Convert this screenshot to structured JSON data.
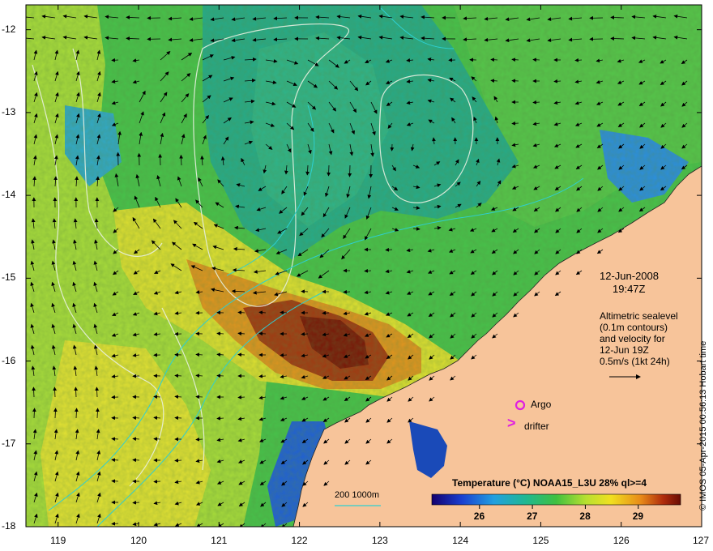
{
  "map": {
    "lon_ticks": [
      "119",
      "120",
      "121",
      "122",
      "123",
      "124",
      "125",
      "126",
      "127"
    ],
    "lat_ticks": [
      "-12",
      "-13",
      "-14",
      "-15",
      "-16",
      "-17",
      "-18"
    ],
    "lon_range": [
      118.6,
      127
    ],
    "lat_range": [
      -18,
      -11.7
    ]
  },
  "annotations": {
    "date": "12-Jun-2008",
    "time": "19:47Z",
    "altimetry_lines": [
      "Altimetric sealevel",
      "(0.1m contours)",
      "and velocity for",
      "12-Jun 19Z",
      "0.5m/s (1kt 24h)"
    ],
    "argo_label": "Argo",
    "drifter_label": "drifter",
    "drifter_symbol": ">",
    "bathy_label": "200  1000m",
    "credit": "© IMOS 05-Apr-2015 00:56:13 Hobart time"
  },
  "legend": {
    "title": "Temperature (°C) NOAA15_L3U 28% ql>=4",
    "ticks": [
      "26",
      "27",
      "28",
      "29"
    ],
    "range_c": [
      25.1,
      29.8
    ]
  },
  "colors": {
    "land": "#f7c49a",
    "green": "#40c04a",
    "teal": "#22a889",
    "lime": "#b8e23a",
    "yellow": "#e8e030",
    "orange": "#d9761a",
    "brown": "#8a1e08",
    "blue": "#1a5ed0",
    "argo": "#e020e0",
    "bathy": "#30d0d0"
  }
}
